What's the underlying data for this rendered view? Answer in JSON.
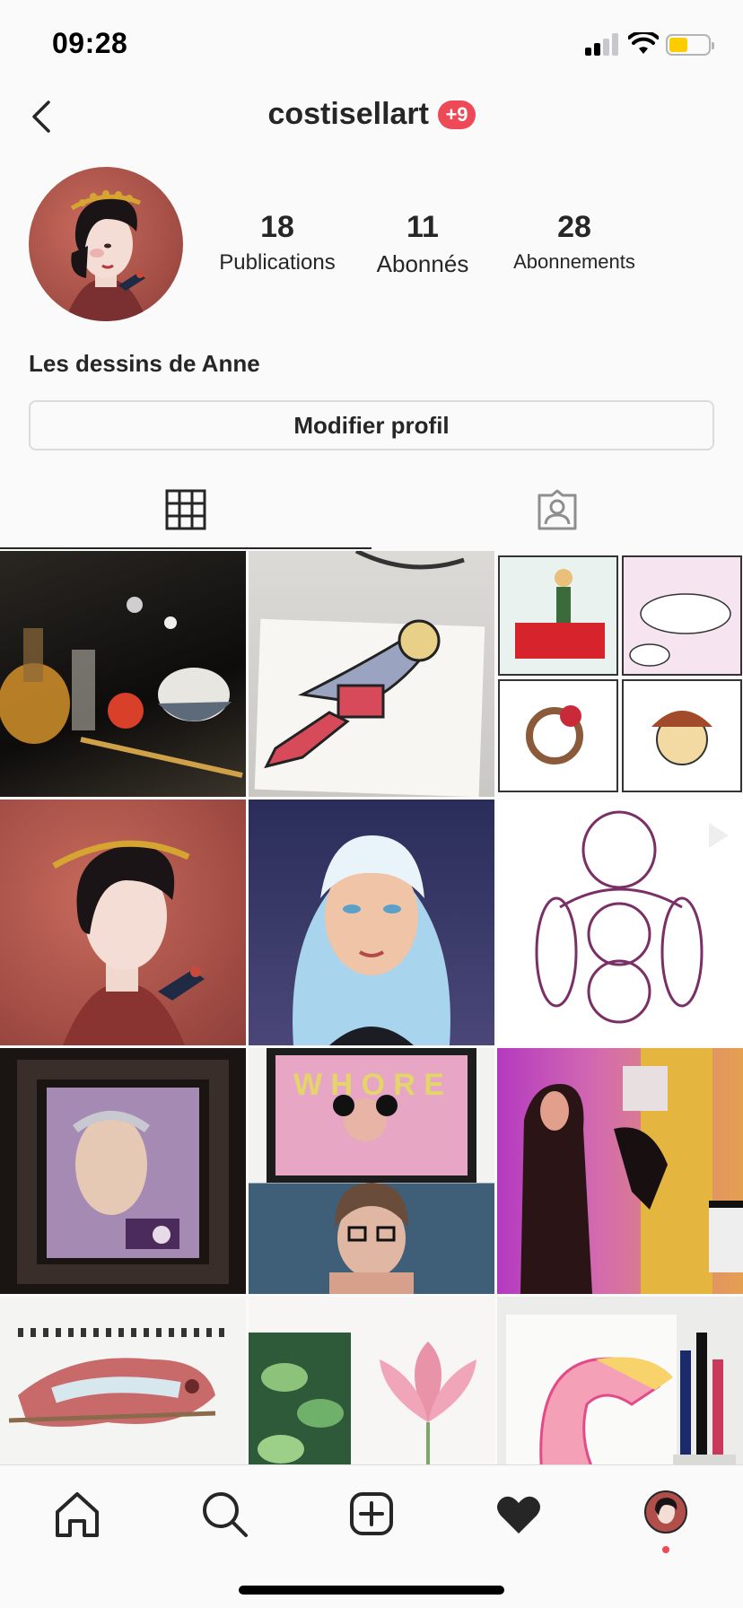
{
  "status_bar": {
    "time": "09:28"
  },
  "header": {
    "username": "costisellart",
    "notification_badge": "+9"
  },
  "profile": {
    "name": "Les dessins de Anne",
    "stats": [
      {
        "value": "18",
        "label": "Publications"
      },
      {
        "value": "11",
        "label": "Abonnés"
      },
      {
        "value": "28",
        "label": "Abonnements"
      }
    ],
    "edit_button": "Modifier profil"
  },
  "tabs": [
    {
      "name": "grid",
      "icon": "grid-icon",
      "active": true
    },
    {
      "name": "tagged",
      "icon": "tagged-person-icon",
      "active": false
    }
  ],
  "posts": [
    {
      "subject": "still-life-painting"
    },
    {
      "subject": "woman-drawing-on-paper"
    },
    {
      "subject": "comic-strip-grid"
    },
    {
      "subject": "woman-with-golden-laurel-illustration"
    },
    {
      "subject": "blue-haired-woman-portrait"
    },
    {
      "subject": "figure-sketch-video"
    },
    {
      "subject": "framed-postage-stamp-art"
    },
    {
      "subject": "whore-painting-with-woman"
    },
    {
      "subject": "woman-beside-sculpture"
    },
    {
      "subject": "chameleon-watercolor-sketchbook"
    },
    {
      "subject": "leaves-and-lotus-watercolor"
    },
    {
      "subject": "toucan-watercolor-with-markers"
    }
  ],
  "bottom_nav": [
    "home-icon",
    "search-icon",
    "add-post-icon",
    "heart-icon",
    "profile-avatar"
  ],
  "colors": {
    "badge": "#ed4956",
    "battery": "#ffcc00",
    "text": "#262626"
  }
}
